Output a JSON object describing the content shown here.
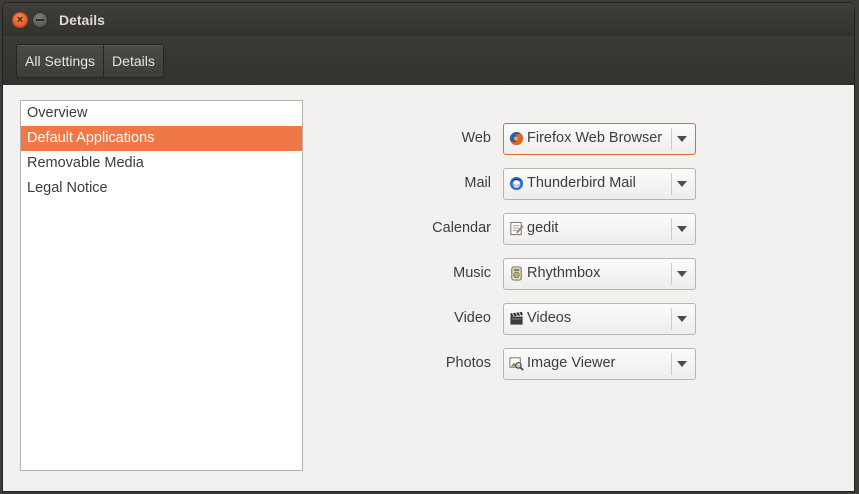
{
  "window": {
    "title": "Details",
    "close_glyph": "×"
  },
  "toolbar": {
    "all_settings_label": "All Settings",
    "details_label": "Details"
  },
  "sidebar": {
    "items": [
      {
        "label": "Overview"
      },
      {
        "label": "Default Applications",
        "selected": true
      },
      {
        "label": "Removable Media"
      },
      {
        "label": "Legal Notice"
      }
    ]
  },
  "defaults": [
    {
      "label": "Web",
      "app": "Firefox Web Browser",
      "icon": "firefox-icon",
      "focused": true
    },
    {
      "label": "Mail",
      "app": "Thunderbird Mail",
      "icon": "thunderbird-icon"
    },
    {
      "label": "Calendar",
      "app": "gedit",
      "icon": "gedit-icon"
    },
    {
      "label": "Music",
      "app": "Rhythmbox",
      "icon": "rhythmbox-icon"
    },
    {
      "label": "Video",
      "app": "Videos",
      "icon": "videos-icon"
    },
    {
      "label": "Photos",
      "app": "Image Viewer",
      "icon": "image-viewer-icon"
    }
  ],
  "colors": {
    "accent": "#f07746",
    "titlebar": "#3c3b37",
    "background": "#f2f1f0"
  }
}
